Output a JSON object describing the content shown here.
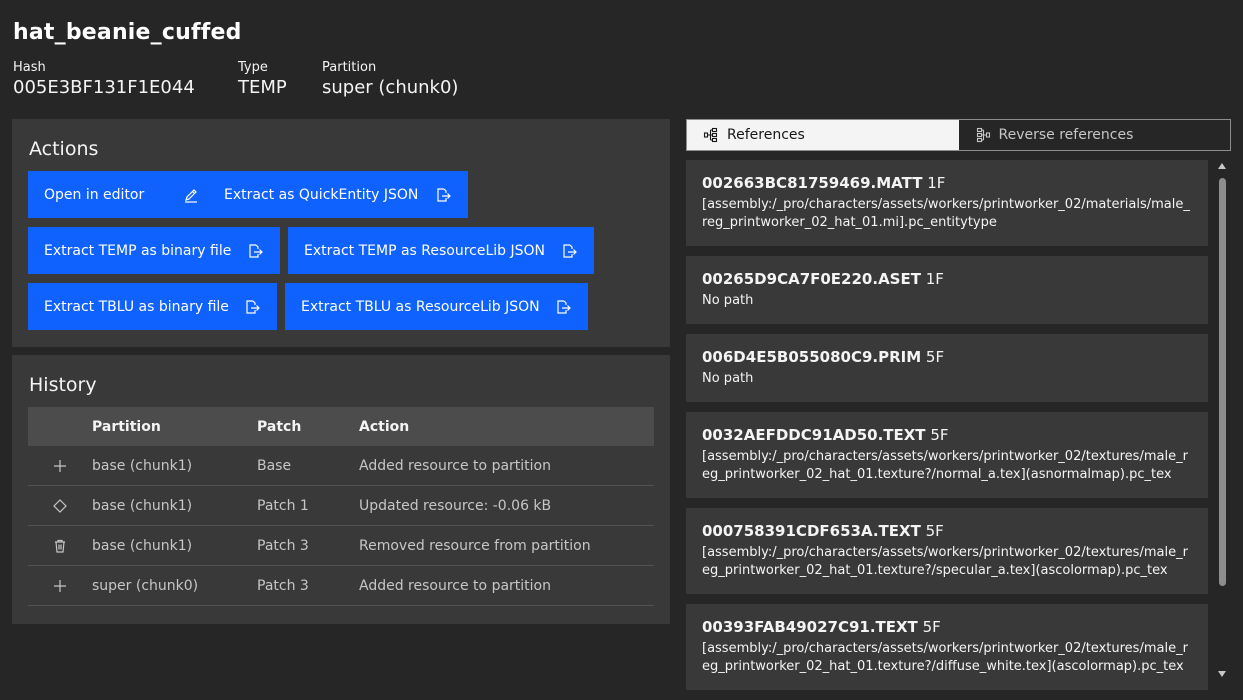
{
  "header": {
    "title": "hat_beanie_cuffed",
    "hash_label": "Hash",
    "hash_value": "005E3BF131F1E044",
    "type_label": "Type",
    "type_value": "TEMP",
    "partition_label": "Partition",
    "partition_value": "super (chunk0)"
  },
  "actions": {
    "title": "Actions",
    "buttons": [
      {
        "label": "Open in editor",
        "icon": "edit-icon"
      },
      {
        "label": "Extract as QuickEntity JSON",
        "icon": "export-icon"
      },
      {
        "label": "Extract TEMP as binary file",
        "icon": "export-icon"
      },
      {
        "label": "Extract TEMP as ResourceLib JSON",
        "icon": "export-icon"
      },
      {
        "label": "Extract TBLU as binary file",
        "icon": "export-icon"
      },
      {
        "label": "Extract TBLU as ResourceLib JSON",
        "icon": "export-icon"
      }
    ]
  },
  "history": {
    "title": "History",
    "columns": [
      "Partition",
      "Patch",
      "Action"
    ],
    "rows": [
      {
        "icon": "add-icon",
        "partition": "base (chunk1)",
        "patch": "Base",
        "action": "Added resource to partition"
      },
      {
        "icon": "diamond-icon",
        "partition": "base (chunk1)",
        "patch": "Patch 1",
        "action": "Updated resource: -0.06 kB"
      },
      {
        "icon": "trash-icon",
        "partition": "base (chunk1)",
        "patch": "Patch 3",
        "action": "Removed resource from partition"
      },
      {
        "icon": "add-icon",
        "partition": "super (chunk0)",
        "patch": "Patch 3",
        "action": "Added resource to partition"
      }
    ]
  },
  "tabs": [
    {
      "label": "References",
      "active": true,
      "icon": "tree-icon"
    },
    {
      "label": "Reverse references",
      "active": false,
      "icon": "tree-reverse-icon"
    }
  ],
  "references": [
    {
      "hash": "002663BC81759469.MATT",
      "flag": "1F",
      "path": "[assembly:/_pro/characters/assets/workers/printworker_02/materials/male_reg_printworker_02_hat_01.mi].pc_entitytype"
    },
    {
      "hash": "00265D9CA7F0E220.ASET",
      "flag": "1F",
      "path": "No path"
    },
    {
      "hash": "006D4E5B055080C9.PRIM",
      "flag": "5F",
      "path": "No path"
    },
    {
      "hash": "0032AEFDDC91AD50.TEXT",
      "flag": "5F",
      "path": "[assembly:/_pro/characters/assets/workers/printworker_02/textures/male_reg_printworker_02_hat_01.texture?/normal_a.tex](asnormalmap).pc_tex"
    },
    {
      "hash": "000758391CDF653A.TEXT",
      "flag": "5F",
      "path": "[assembly:/_pro/characters/assets/workers/printworker_02/textures/male_reg_printworker_02_hat_01.texture?/specular_a.tex](ascolormap).pc_tex"
    },
    {
      "hash": "00393FAB49027C91.TEXT",
      "flag": "5F",
      "path": "[assembly:/_pro/characters/assets/workers/printworker_02/textures/male_reg_printworker_02_hat_01.texture?/diffuse_white.tex](ascolormap).pc_tex"
    }
  ],
  "colors": {
    "background": "#262626",
    "panel": "#393939",
    "accent": "#0f62fe"
  }
}
